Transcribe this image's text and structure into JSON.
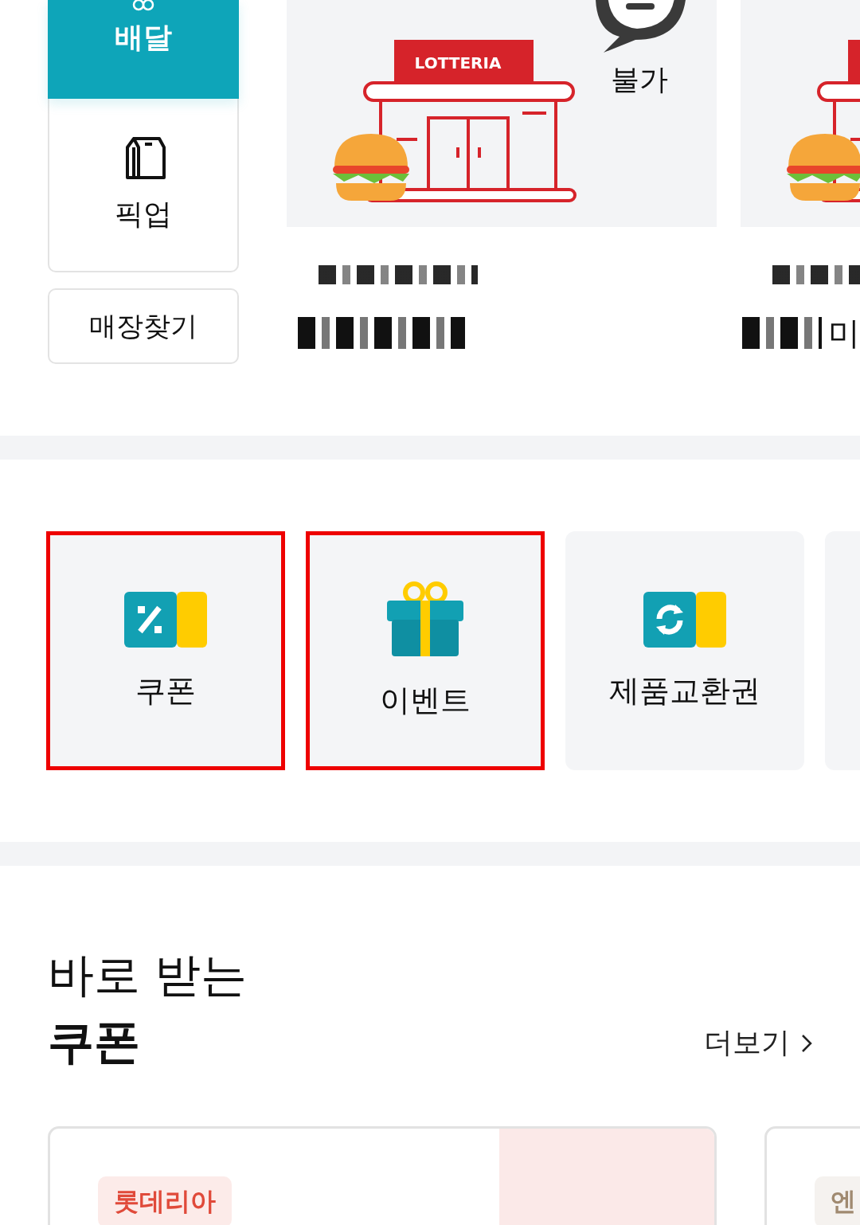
{
  "order_modes": [
    {
      "label": "배달",
      "kind": "delivery",
      "selected": true
    },
    {
      "label": "픽업",
      "kind": "pickup",
      "selected": false
    }
  ],
  "find_store_button": "매장찾기",
  "stores": [
    {
      "sign": "LOTTERIA",
      "status": "불가"
    },
    {
      "name_tail": "미"
    }
  ],
  "menu_tiles": [
    {
      "kind": "coupon",
      "label": "쿠폰",
      "highlighted": true
    },
    {
      "kind": "event",
      "label": "이벤트",
      "highlighted": true
    },
    {
      "kind": "voucher",
      "label": "제품교환권",
      "highlighted": false
    },
    {
      "kind": "blank",
      "highlighted": false
    }
  ],
  "coupon_section": {
    "title_line1": "바로 받는",
    "title_line2": "쿠폰",
    "more_link": "더보기"
  },
  "coupons": [
    {
      "brand": "롯데리아",
      "color": "#e04a3a"
    },
    {
      "brand": "엔",
      "color": "#a08a70"
    }
  ]
}
